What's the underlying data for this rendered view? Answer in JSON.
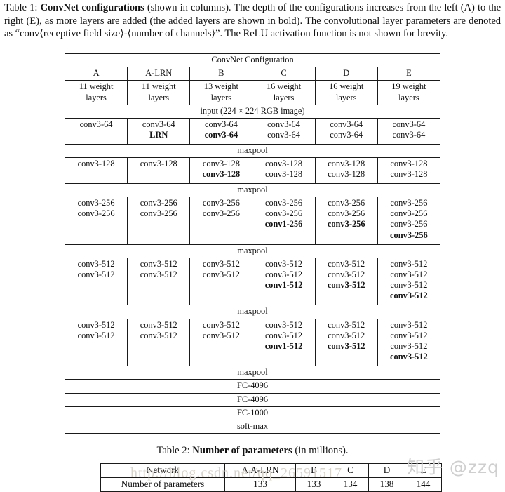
{
  "caption": {
    "prefix": "Table 1: ",
    "bold_title": "ConvNet configurations",
    "body": " (shown in columns).  The depth of the configurations increases from the left (A) to the right (E), as more layers are added (the added layers are shown in bold).  The convolutional layer parameters are denoted as “conv⟨receptive field size⟩-⟨number of channels⟩”.  The ReLU activation function is not shown for brevity."
  },
  "table1": {
    "header_span": "ConvNet Configuration",
    "columns": [
      "A",
      "A-LRN",
      "B",
      "C",
      "D",
      "E"
    ],
    "depth_row": [
      "11 weight\nlayers",
      "11 weight\nlayers",
      "13 weight\nlayers",
      "16 weight\nlayers",
      "16 weight\nlayers",
      "19 weight\nlayers"
    ],
    "input_row": "input (224 × 224 RGB image)",
    "maxpool_label": "maxpool",
    "blocks": [
      {
        "name": "block-64",
        "cells": [
          [
            {
              "t": "conv3-64",
              "b": false
            }
          ],
          [
            {
              "t": "conv3-64",
              "b": false
            },
            {
              "t": "LRN",
              "b": true
            }
          ],
          [
            {
              "t": "conv3-64",
              "b": false
            },
            {
              "t": "conv3-64",
              "b": true
            }
          ],
          [
            {
              "t": "conv3-64",
              "b": false
            },
            {
              "t": "conv3-64",
              "b": false
            }
          ],
          [
            {
              "t": "conv3-64",
              "b": false
            },
            {
              "t": "conv3-64",
              "b": false
            }
          ],
          [
            {
              "t": "conv3-64",
              "b": false
            },
            {
              "t": "conv3-64",
              "b": false
            }
          ]
        ]
      },
      {
        "name": "block-128",
        "cells": [
          [
            {
              "t": "conv3-128",
              "b": false
            }
          ],
          [
            {
              "t": "conv3-128",
              "b": false
            }
          ],
          [
            {
              "t": "conv3-128",
              "b": false
            },
            {
              "t": "conv3-128",
              "b": true
            }
          ],
          [
            {
              "t": "conv3-128",
              "b": false
            },
            {
              "t": "conv3-128",
              "b": false
            }
          ],
          [
            {
              "t": "conv3-128",
              "b": false
            },
            {
              "t": "conv3-128",
              "b": false
            }
          ],
          [
            {
              "t": "conv3-128",
              "b": false
            },
            {
              "t": "conv3-128",
              "b": false
            }
          ]
        ]
      },
      {
        "name": "block-256",
        "cells": [
          [
            {
              "t": "conv3-256",
              "b": false
            },
            {
              "t": "conv3-256",
              "b": false
            }
          ],
          [
            {
              "t": "conv3-256",
              "b": false
            },
            {
              "t": "conv3-256",
              "b": false
            }
          ],
          [
            {
              "t": "conv3-256",
              "b": false
            },
            {
              "t": "conv3-256",
              "b": false
            }
          ],
          [
            {
              "t": "conv3-256",
              "b": false
            },
            {
              "t": "conv3-256",
              "b": false
            },
            {
              "t": "conv1-256",
              "b": true
            }
          ],
          [
            {
              "t": "conv3-256",
              "b": false
            },
            {
              "t": "conv3-256",
              "b": false
            },
            {
              "t": "conv3-256",
              "b": true
            }
          ],
          [
            {
              "t": "conv3-256",
              "b": false
            },
            {
              "t": "conv3-256",
              "b": false
            },
            {
              "t": "conv3-256",
              "b": false
            },
            {
              "t": "conv3-256",
              "b": true
            }
          ]
        ]
      },
      {
        "name": "block-512-a",
        "cells": [
          [
            {
              "t": "conv3-512",
              "b": false
            },
            {
              "t": "conv3-512",
              "b": false
            }
          ],
          [
            {
              "t": "conv3-512",
              "b": false
            },
            {
              "t": "conv3-512",
              "b": false
            }
          ],
          [
            {
              "t": "conv3-512",
              "b": false
            },
            {
              "t": "conv3-512",
              "b": false
            }
          ],
          [
            {
              "t": "conv3-512",
              "b": false
            },
            {
              "t": "conv3-512",
              "b": false
            },
            {
              "t": "conv1-512",
              "b": true
            }
          ],
          [
            {
              "t": "conv3-512",
              "b": false
            },
            {
              "t": "conv3-512",
              "b": false
            },
            {
              "t": "conv3-512",
              "b": true
            }
          ],
          [
            {
              "t": "conv3-512",
              "b": false
            },
            {
              "t": "conv3-512",
              "b": false
            },
            {
              "t": "conv3-512",
              "b": false
            },
            {
              "t": "conv3-512",
              "b": true
            }
          ]
        ]
      },
      {
        "name": "block-512-b",
        "cells": [
          [
            {
              "t": "conv3-512",
              "b": false
            },
            {
              "t": "conv3-512",
              "b": false
            }
          ],
          [
            {
              "t": "conv3-512",
              "b": false
            },
            {
              "t": "conv3-512",
              "b": false
            }
          ],
          [
            {
              "t": "conv3-512",
              "b": false
            },
            {
              "t": "conv3-512",
              "b": false
            }
          ],
          [
            {
              "t": "conv3-512",
              "b": false
            },
            {
              "t": "conv3-512",
              "b": false
            },
            {
              "t": "conv1-512",
              "b": true
            }
          ],
          [
            {
              "t": "conv3-512",
              "b": false
            },
            {
              "t": "conv3-512",
              "b": false
            },
            {
              "t": "conv3-512",
              "b": true
            }
          ],
          [
            {
              "t": "conv3-512",
              "b": false
            },
            {
              "t": "conv3-512",
              "b": false
            },
            {
              "t": "conv3-512",
              "b": false
            },
            {
              "t": "conv3-512",
              "b": true
            }
          ]
        ]
      }
    ],
    "tail_rows": [
      "maxpool",
      "FC-4096",
      "FC-4096",
      "FC-1000",
      "soft-max"
    ]
  },
  "table2": {
    "title_prefix": "Table 2: ",
    "title_bold": "Number of parameters",
    "title_suffix": " (in millions).",
    "rows": [
      {
        "label": "Network",
        "values": [
          "A,A-LRN",
          "B",
          "C",
          "D",
          "E"
        ]
      },
      {
        "label": "Number of parameters",
        "values": [
          "133",
          "133",
          "134",
          "138",
          "144"
        ]
      }
    ]
  },
  "watermarks": {
    "csdn": "http://blog.csdn.net/qq_26591517",
    "zhihu": "知乎 @zzq"
  }
}
